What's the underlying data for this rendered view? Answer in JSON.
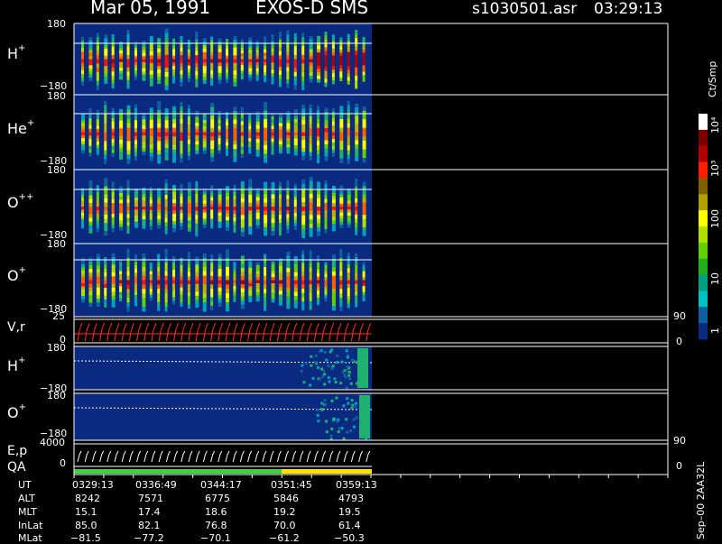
{
  "header": {
    "date": "Mar 05, 1991",
    "mission": "EXOS-D SMS",
    "file": "s1030501.asr",
    "time": "03:29:13"
  },
  "panels": [
    {
      "label": "H",
      "sup": "+",
      "top_tick": "180",
      "bottom_tick": "−180"
    },
    {
      "label": "He",
      "sup": "+",
      "top_tick": "180",
      "bottom_tick": "−180"
    },
    {
      "label": "O",
      "sup": "++",
      "top_tick": "180",
      "bottom_tick": "−180"
    },
    {
      "label": "O",
      "sup": "+",
      "top_tick": "180",
      "bottom_tick": "−180"
    }
  ],
  "velocity_panel": {
    "label": "V,r",
    "top_tick": "25",
    "bottom_tick": "0",
    "right_top": "90",
    "right_bottom": "0"
  },
  "lower_panels": [
    {
      "label": "H",
      "sup": "+",
      "top_tick": "180",
      "bottom_tick": "−180"
    },
    {
      "label": "O",
      "sup": "+",
      "top_tick": "180",
      "bottom_tick": "−180"
    }
  ],
  "ep_panel": {
    "label": "E,p",
    "top_tick": "4000",
    "bottom_tick": "0",
    "right_top": "90",
    "right_bottom": "0"
  },
  "qa_label": "QA",
  "colorbar": {
    "unit": "Ct/Smp",
    "labels": [
      "10⁴",
      "10³",
      "100",
      "10",
      "1"
    ],
    "colors": [
      "#ffffff",
      "#7a0000",
      "#b00000",
      "#ff2000",
      "#806000",
      "#b0a000",
      "#ffff00",
      "#b0e000",
      "#60d000",
      "#20b020",
      "#00a080",
      "#00c0c0",
      "#1060a0",
      "#0a2a80"
    ]
  },
  "ephemeris": {
    "row_labels": [
      "UT",
      "ALT",
      "MLT",
      "InLat",
      "MLat"
    ],
    "columns": [
      [
        "0329:13",
        "8242",
        "15.1",
        "85.0",
        "−81.5"
      ],
      [
        "0336:49",
        "7571",
        "17.4",
        "82.1",
        "−77.2"
      ],
      [
        "0344:17",
        "6775",
        "18.6",
        "76.8",
        "−70.1"
      ],
      [
        "0351:45",
        "5846",
        "19.2",
        "70.0",
        "−61.2"
      ],
      [
        "0359:13",
        "4793",
        "19.5",
        "61.4",
        "−50.3"
      ]
    ]
  },
  "footer_note": "Sep–00 2AA32L",
  "chart_data": {
    "type": "heatmap",
    "title": "Mar 05, 1991   EXOS-D SMS",
    "x": [
      "0329:13",
      "0336:49",
      "0344:17",
      "0351:45",
      "0359:13"
    ],
    "panels": [
      "H+",
      "He+",
      "O++",
      "O+",
      "V,r",
      "H+",
      "O+",
      "E,p"
    ],
    "ylim_pitch": [
      -180,
      180
    ],
    "ylim_vr": [
      0,
      25
    ],
    "ylim_ep": [
      0,
      4000
    ],
    "color_scale": {
      "unit": "Ct/Smp",
      "scale": "log",
      "range": [
        1,
        10000
      ]
    }
  }
}
